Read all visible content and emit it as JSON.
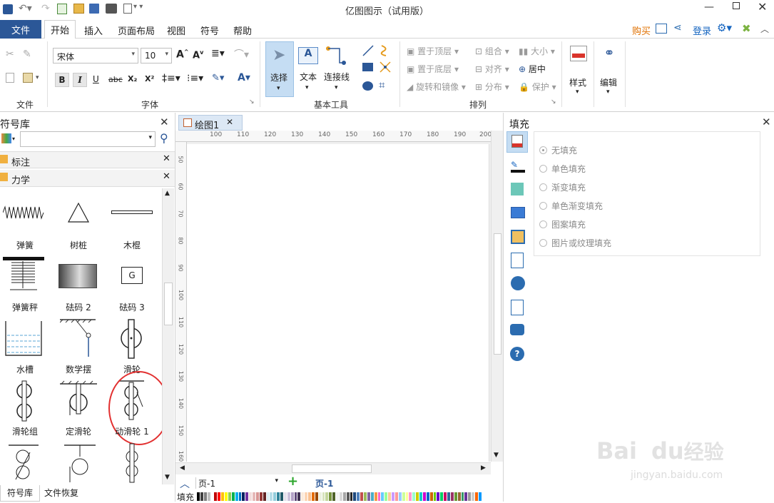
{
  "app": {
    "title": "亿图图示（试用版）"
  },
  "menu": {
    "file": "文件",
    "tabs": [
      "开始",
      "插入",
      "页面布局",
      "视图",
      "符号",
      "帮助"
    ],
    "buy": "购买",
    "login": "登录"
  },
  "ribbon": {
    "font_name": "宋体",
    "font_size": "10",
    "groups": {
      "file": "文件",
      "font": "字体",
      "basic_tools": "基本工具",
      "arrange": "排列"
    },
    "tools": {
      "select": "选择",
      "text": "文本",
      "connector": "连接线"
    },
    "arrange": {
      "bring_front": "置于顶层",
      "send_back": "置于底层",
      "rotate": "旋转和镜像",
      "group": "组合",
      "align": "对齐",
      "distribute": "分布",
      "size": "大小",
      "center": "居中",
      "protect": "保护"
    },
    "style": "样式",
    "edit": "编辑",
    "fmt": {
      "bold": "B",
      "italic": "I",
      "underline": "U",
      "strike": "abc",
      "sub": "X₂",
      "sup": "X²"
    }
  },
  "library": {
    "title": "符号库",
    "categories": [
      "标注",
      "力学"
    ],
    "symbols": [
      "弹簧",
      "树桩",
      "木棍",
      "弹簧秤",
      "砝码 2",
      "砝码 3",
      "水槽",
      "数学摆",
      "滑轮",
      "滑轮组",
      "定滑轮",
      "动滑轮 1"
    ],
    "weight_label": "G",
    "bottom_tabs": [
      "符号库",
      "文件恢复"
    ]
  },
  "document": {
    "tab": "绘图1",
    "ruler_h": [
      "100",
      "110",
      "120",
      "130",
      "140",
      "150",
      "160",
      "170",
      "180",
      "190",
      "200"
    ],
    "ruler_v": [
      "50",
      "60",
      "70",
      "80",
      "90",
      "100",
      "110",
      "120",
      "130",
      "140",
      "150",
      "160"
    ],
    "page_select": "页-1",
    "page_tab": "页-1",
    "fill_label": "填充"
  },
  "fill_panel": {
    "title": "填充",
    "options": [
      "无填充",
      "单色填充",
      "渐变填充",
      "单色渐变填充",
      "图案填充",
      "图片或纹理填充"
    ],
    "selected": 0
  },
  "watermark": {
    "brand": "Bai",
    "brand2": "du",
    "cn": "经验",
    "url": "jingyan.baidu.com"
  },
  "colors": {
    "accent": "#2b5797",
    "buy": "#e07000",
    "login": "#1565c0",
    "selected_tool": "#c5ddf3",
    "highlight": "#e23030"
  },
  "palette": [
    "#000000",
    "#404040",
    "#7f7f7f",
    "#bfbfbf",
    "#ffffff",
    "#c00000",
    "#ff0000",
    "#ffc000",
    "#ffff00",
    "#92d050",
    "#00b050",
    "#00b0f0",
    "#0070c0",
    "#002060",
    "#7030a0",
    "#f2dcdb",
    "#e6b9b8",
    "#d99694",
    "#953735",
    "#632423",
    "#dbeef3",
    "#b7dde8",
    "#92cddc",
    "#31859b",
    "#215968",
    "#e5e0ec",
    "#ccc1da",
    "#b3a2c7",
    "#604a7b",
    "#403152",
    "#fdeada",
    "#fcd5b5",
    "#fac08f",
    "#e46c0a",
    "#984807",
    "#ebf1de",
    "#d7e4bd",
    "#c3d69b",
    "#77933c",
    "#4f6228",
    "#f2f2f2",
    "#d9d9d9",
    "#a6a6a6",
    "#595959",
    "#262626",
    "#1f497d",
    "#4f81bd",
    "#c0504d",
    "#9bbb59",
    "#8064a2",
    "#4bacc6",
    "#f79646",
    "#ff66cc",
    "#66ccff",
    "#99ff99",
    "#ffcc99",
    "#cc99ff",
    "#ff9999",
    "#99ccff",
    "#ccff99",
    "#ffff99",
    "#ff99cc",
    "#99ffcc",
    "#cccc00",
    "#00cccc",
    "#cc00cc",
    "#0066cc",
    "#cc6600",
    "#66cc00",
    "#6600cc",
    "#00cc66",
    "#cc0066",
    "#336699",
    "#993366",
    "#669933",
    "#996633",
    "#339966",
    "#663399",
    "#999999",
    "#cccccc",
    "#ff6600",
    "#0099ff"
  ]
}
